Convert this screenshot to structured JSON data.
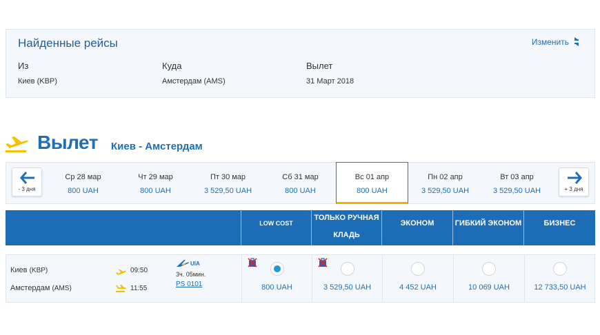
{
  "summary": {
    "title": "Найденные рейсы",
    "change_label": "Изменить",
    "from_label": "Из",
    "from_value": "Киев (KBP)",
    "to_label": "Куда",
    "to_value": "Амстердам (AMS)",
    "departure_label": "Вылет",
    "departure_value": "31 Март 2018"
  },
  "heading": {
    "title": "Вылет",
    "route": "Киев - Амстердам"
  },
  "datestrip": {
    "prev_label": "- 3 дня",
    "next_label": "+ 3 дня",
    "days": [
      {
        "date": "Ср 28 мар",
        "price": "800 UAH"
      },
      {
        "date": "Чт 29 мар",
        "price": "800 UAH"
      },
      {
        "date": "Пт 30 мар",
        "price": "3 529,50 UAH"
      },
      {
        "date": "Сб 31 мар",
        "price": "800 UAH"
      },
      {
        "date": "Вс 01 апр",
        "price": "800 UAH"
      },
      {
        "date": "Пн 02 апр",
        "price": "3 529,50 UAH"
      },
      {
        "date": "Вт 03 апр",
        "price": "3 529,50 UAH"
      }
    ],
    "active_index": 4
  },
  "fare_header": {
    "low_cost": "LOW COST",
    "hand_luggage_line1": "ТОЛЬКО РУЧНАЯ",
    "hand_luggage_line2": "КЛАДЬ",
    "economy": "ЭКОНОМ",
    "flex_economy": "ГИБКИЙ ЭКОНОМ",
    "business": "БИЗНЕС"
  },
  "flight": {
    "from_city": "Киев",
    "from_code": "(KBP)",
    "dep_time": "09:50",
    "to_city": "Амстердам",
    "to_code": "(AMS)",
    "arr_time": "11:55",
    "airline_code": "UIA",
    "duration": "3ч. 05мин.",
    "flight_number": "PS 0101",
    "fares": [
      {
        "price": "800 UAH",
        "selected": true,
        "no_bag": true
      },
      {
        "price": "3 529,50 UAH",
        "selected": false,
        "no_bag": true
      },
      {
        "price": "4 452 UAH",
        "selected": false,
        "no_bag": false
      },
      {
        "price": "10 069 UAH",
        "selected": false,
        "no_bag": false
      },
      {
        "price": "12 733,50 UAH",
        "selected": false,
        "no_bag": false
      }
    ]
  },
  "colors": {
    "brand_blue": "#1c6cb6",
    "accent_yellow": "#f2c200",
    "radio_selected": "#1a9ad9"
  }
}
